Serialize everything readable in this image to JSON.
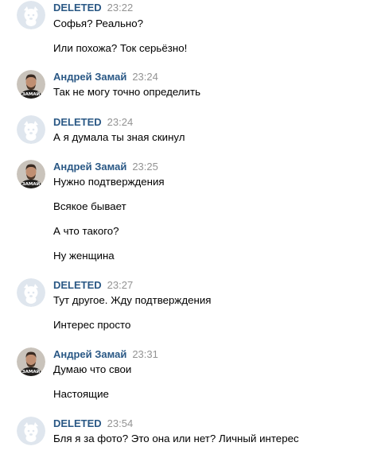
{
  "colors": {
    "author": "#2a5885",
    "time": "#939393",
    "text": "#000000",
    "deleted_avatar_bg": "#dfe6ee"
  },
  "groups": [
    {
      "author": "DELETED",
      "avatar": "deleted-dog-icon",
      "time": "23:22",
      "messages": [
        "Софья? Реально?",
        "Или похожа? Ток серьёзно!"
      ]
    },
    {
      "author": "Андрей Замай",
      "avatar": "user-photo",
      "avatar_text": "ЗАМАЙ",
      "time": "23:24",
      "messages": [
        "Так не могу точно определить"
      ]
    },
    {
      "author": "DELETED",
      "avatar": "deleted-dog-icon",
      "time": "23:24",
      "messages": [
        "А я думала ты зная скинул"
      ]
    },
    {
      "author": "Андрей Замай",
      "avatar": "user-photo",
      "avatar_text": "ЗАМАЙ",
      "time": "23:25",
      "messages": [
        "Нужно подтверждения",
        "Всякое бывает",
        "А что такого?",
        "Ну женщина"
      ]
    },
    {
      "author": "DELETED",
      "avatar": "deleted-dog-icon",
      "time": "23:27",
      "messages": [
        "Тут другое. Жду подтверждения",
        "Интерес просто"
      ]
    },
    {
      "author": "Андрей Замай",
      "avatar": "user-photo",
      "avatar_text": "ЗАМАЙ",
      "time": "23:31",
      "messages": [
        "Думаю что свои",
        "Настоящие"
      ]
    },
    {
      "author": "DELETED",
      "avatar": "deleted-dog-icon",
      "time": "23:54",
      "messages": [
        "Бля я за фото? Это она или нет? Личный интерес"
      ]
    }
  ]
}
